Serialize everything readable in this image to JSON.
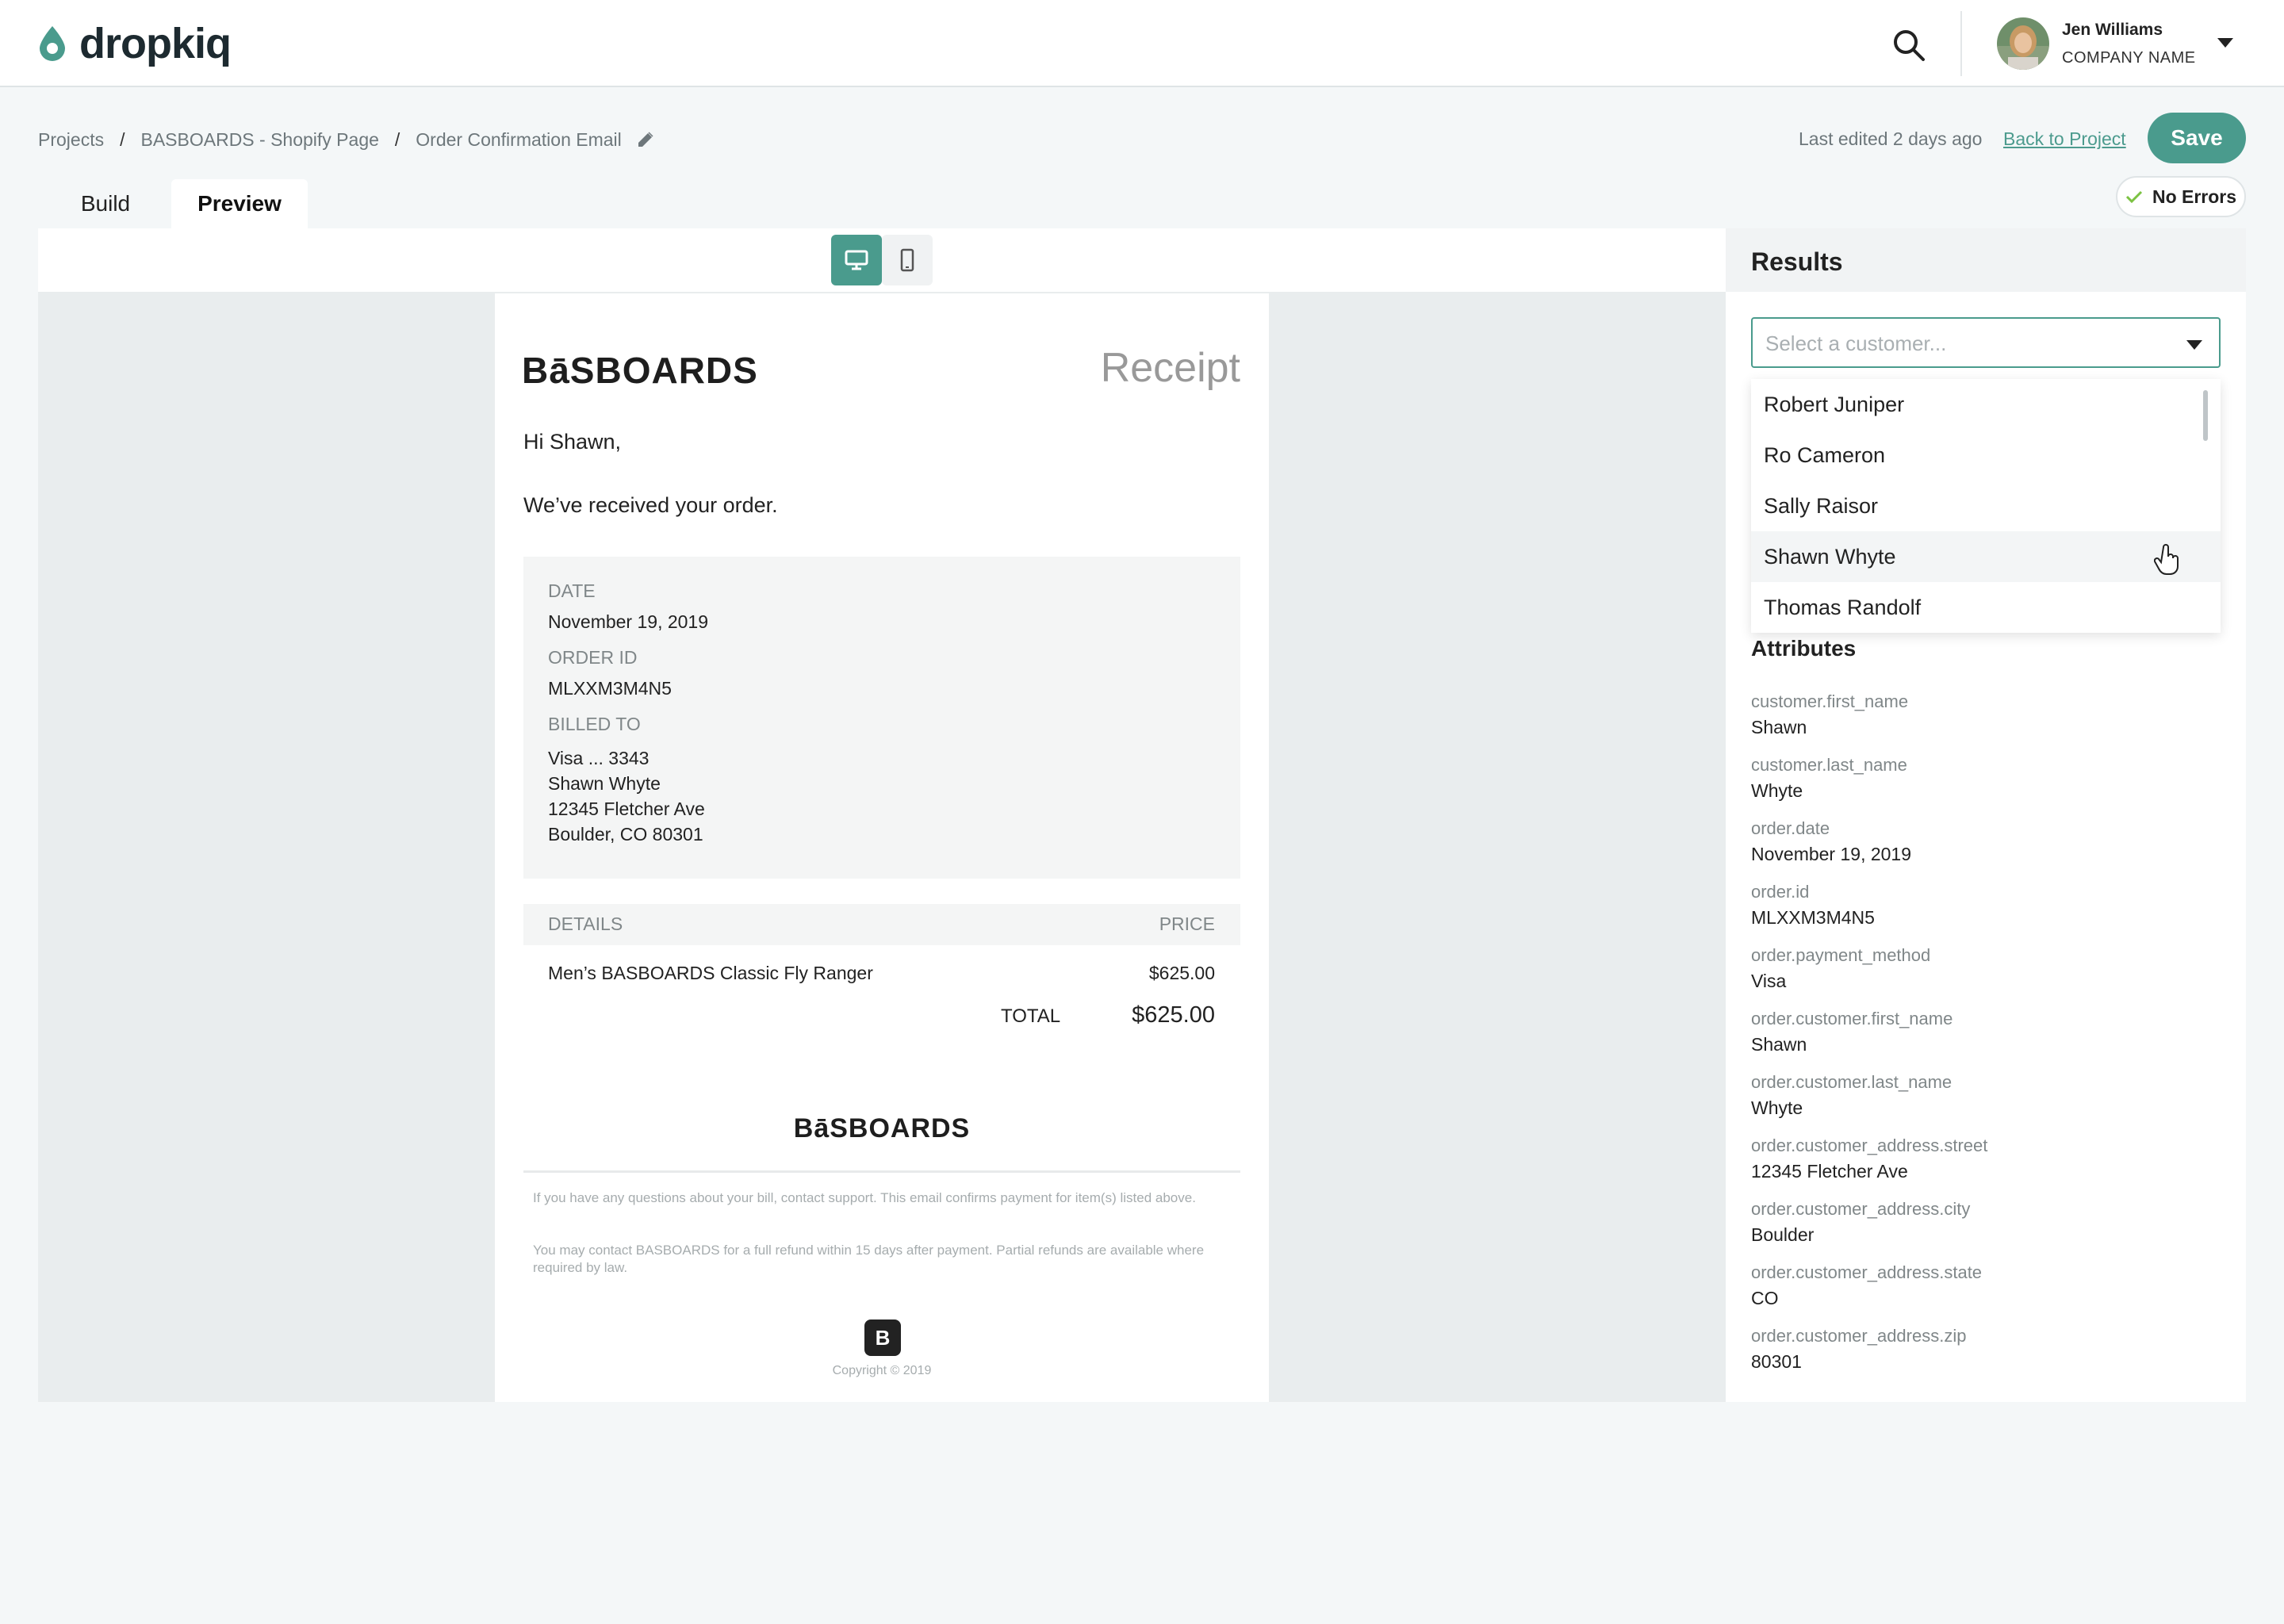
{
  "app": {
    "brand": "dropkiq",
    "user_name": "Jen Williams",
    "company_name": "COMPANY NAME"
  },
  "breadcrumb": {
    "projects": "Projects",
    "project": "BASBOARDS - Shopify Page",
    "page": "Order Confirmation Email"
  },
  "header": {
    "last_edited": "Last edited 2 days ago",
    "back_link": "Back to Project",
    "save_label": "Save"
  },
  "tabs": {
    "build": "Build",
    "preview": "Preview"
  },
  "status": {
    "no_errors": "No Errors"
  },
  "email": {
    "logo": "BāSBOARDS",
    "receipt": "Receipt",
    "greeting": "Hi Shawn,",
    "received": "We’ve received your order.",
    "date_label": "DATE",
    "date_value": "November 19, 2019",
    "order_id_label": "ORDER ID",
    "order_id_value": "MLXXM3M4N5",
    "billed_to_label": "BILLED TO",
    "billed_lines": [
      "Visa ... 3343",
      "Shawn Whyte",
      "12345 Fletcher Ave",
      "Boulder, CO 80301"
    ],
    "details_label": "DETAILS",
    "price_label": "PRICE",
    "item_name": "Men’s BASBOARDS Classic Fly Ranger",
    "item_price": "$625.00",
    "total_label": "TOTAL",
    "total_value": "$625.00",
    "footer_logo": "BāSBOARDS",
    "fine_print_1": "If you have any questions about your bill, contact support. This email confirms payment for item(s) listed above.",
    "fine_print_2": "You may contact BASBOARDS for a full refund within 15 days after payment. Partial refunds are available where required by law.",
    "badge_letter": "B",
    "copyright": "Copyright © 2019"
  },
  "results": {
    "title": "Results",
    "select_placeholder": "Select a customer...",
    "customers": [
      "Robert Juniper",
      "Ro Cameron",
      "Sally Raisor",
      "Shawn Whyte",
      "Thomas Randolf"
    ],
    "attributes_title": "Attributes",
    "attributes": [
      {
        "key": "customer.first_name",
        "value": "Shawn"
      },
      {
        "key": "customer.last_name",
        "value": "Whyte"
      },
      {
        "key": "order.date",
        "value": "November 19, 2019"
      },
      {
        "key": "order.id",
        "value": "MLXXM3M4N5"
      },
      {
        "key": "order.payment_method",
        "value": "Visa"
      },
      {
        "key": "order.customer.first_name",
        "value": "Shawn"
      },
      {
        "key": "order.customer.last_name",
        "value": "Whyte"
      },
      {
        "key": "order.customer_address.street",
        "value": "12345 Fletcher Ave"
      },
      {
        "key": "order.customer_address.city",
        "value": "Boulder"
      },
      {
        "key": "order.customer_address.state",
        "value": "CO"
      },
      {
        "key": "order.customer_address.zip",
        "value": "80301"
      }
    ]
  },
  "colors": {
    "accent": "#4a9b8d",
    "check": "#7cc242"
  }
}
